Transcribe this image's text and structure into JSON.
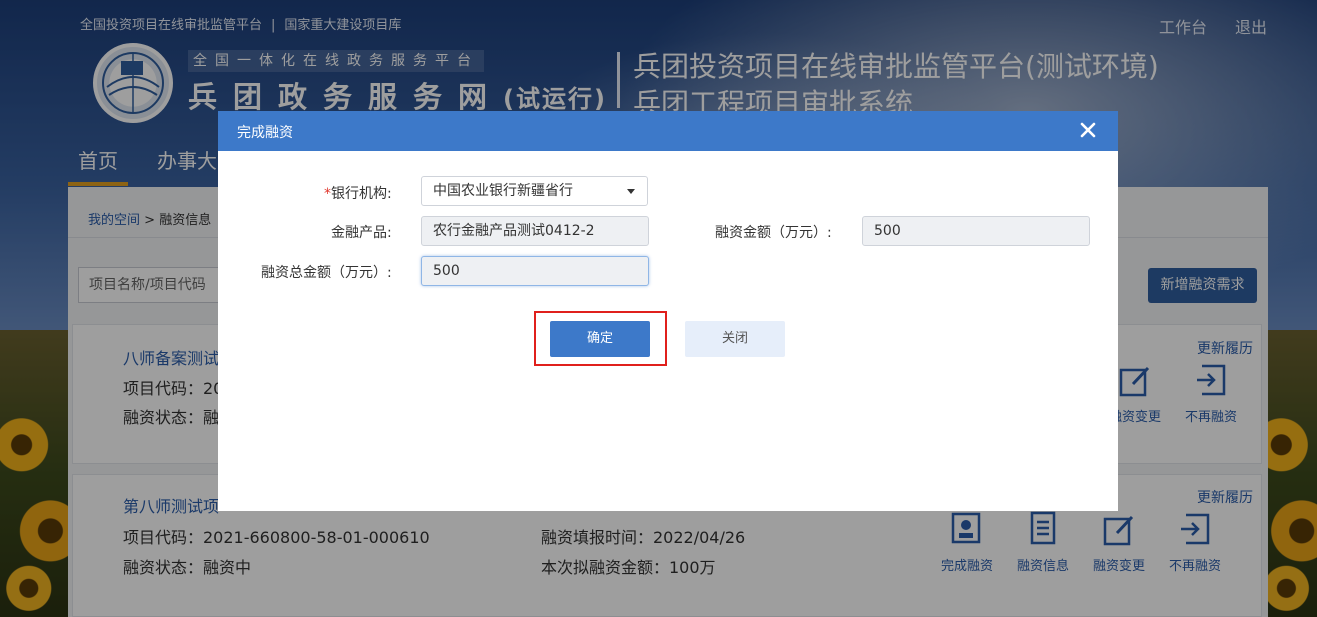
{
  "header": {
    "top_links": [
      "全国投资项目在线审批监管平台",
      "国家重大建设项目库"
    ],
    "top_sep": "|",
    "workbench": "工作台",
    "logout": "退出",
    "brand_sub": "全国一体化在线政务服务平台",
    "brand_main": "兵团政务服务网",
    "brand_suffix": "(试运行)",
    "system_title_1": "兵团投资项目在线审批监管平台(测试环境)",
    "system_title_2": "兵团工程项目审批系统"
  },
  "nav": {
    "home": "首页",
    "office": "办事大"
  },
  "breadcrumb": {
    "space": "我的空间",
    "sep": " > ",
    "current": "融资信息"
  },
  "search": {
    "placeholder": "项目名称/项目代码"
  },
  "new_button": "新增融资需求",
  "cards": [
    {
      "title": "八师备案测试",
      "code_label": "项目代码：20",
      "status_label": "融资状态：融",
      "history": "更新履历",
      "actions": [
        "融资变更",
        "不再融资"
      ]
    },
    {
      "title": "第八师测试项",
      "code": "项目代码：2021-660800-58-01-000610",
      "status": "融资状态：融资中",
      "fill_time": "融资填报时间：2022/04/26",
      "amount": "本次拟融资金额：100万",
      "history": "更新履历",
      "actions": [
        "完成融资",
        "融资信息",
        "融资变更",
        "不再融资"
      ]
    }
  ],
  "modal": {
    "title": "完成融资",
    "fields": {
      "bank_required_mark": "*",
      "bank_label": "银行机构:",
      "bank_value": "中国农业银行新疆省行",
      "product_label": "金融产品:",
      "product_value": "农行金融产品测试0412-2",
      "amount_label": "融资金额（万元）:",
      "amount_value": "500",
      "total_label": "融资总金额（万元）:",
      "total_value": "500"
    },
    "confirm": "确定",
    "close": "关闭"
  },
  "colors": {
    "modal_header": "#3d79c9",
    "highlight_border": "#e0201c",
    "link_blue": "#2a5caa"
  }
}
